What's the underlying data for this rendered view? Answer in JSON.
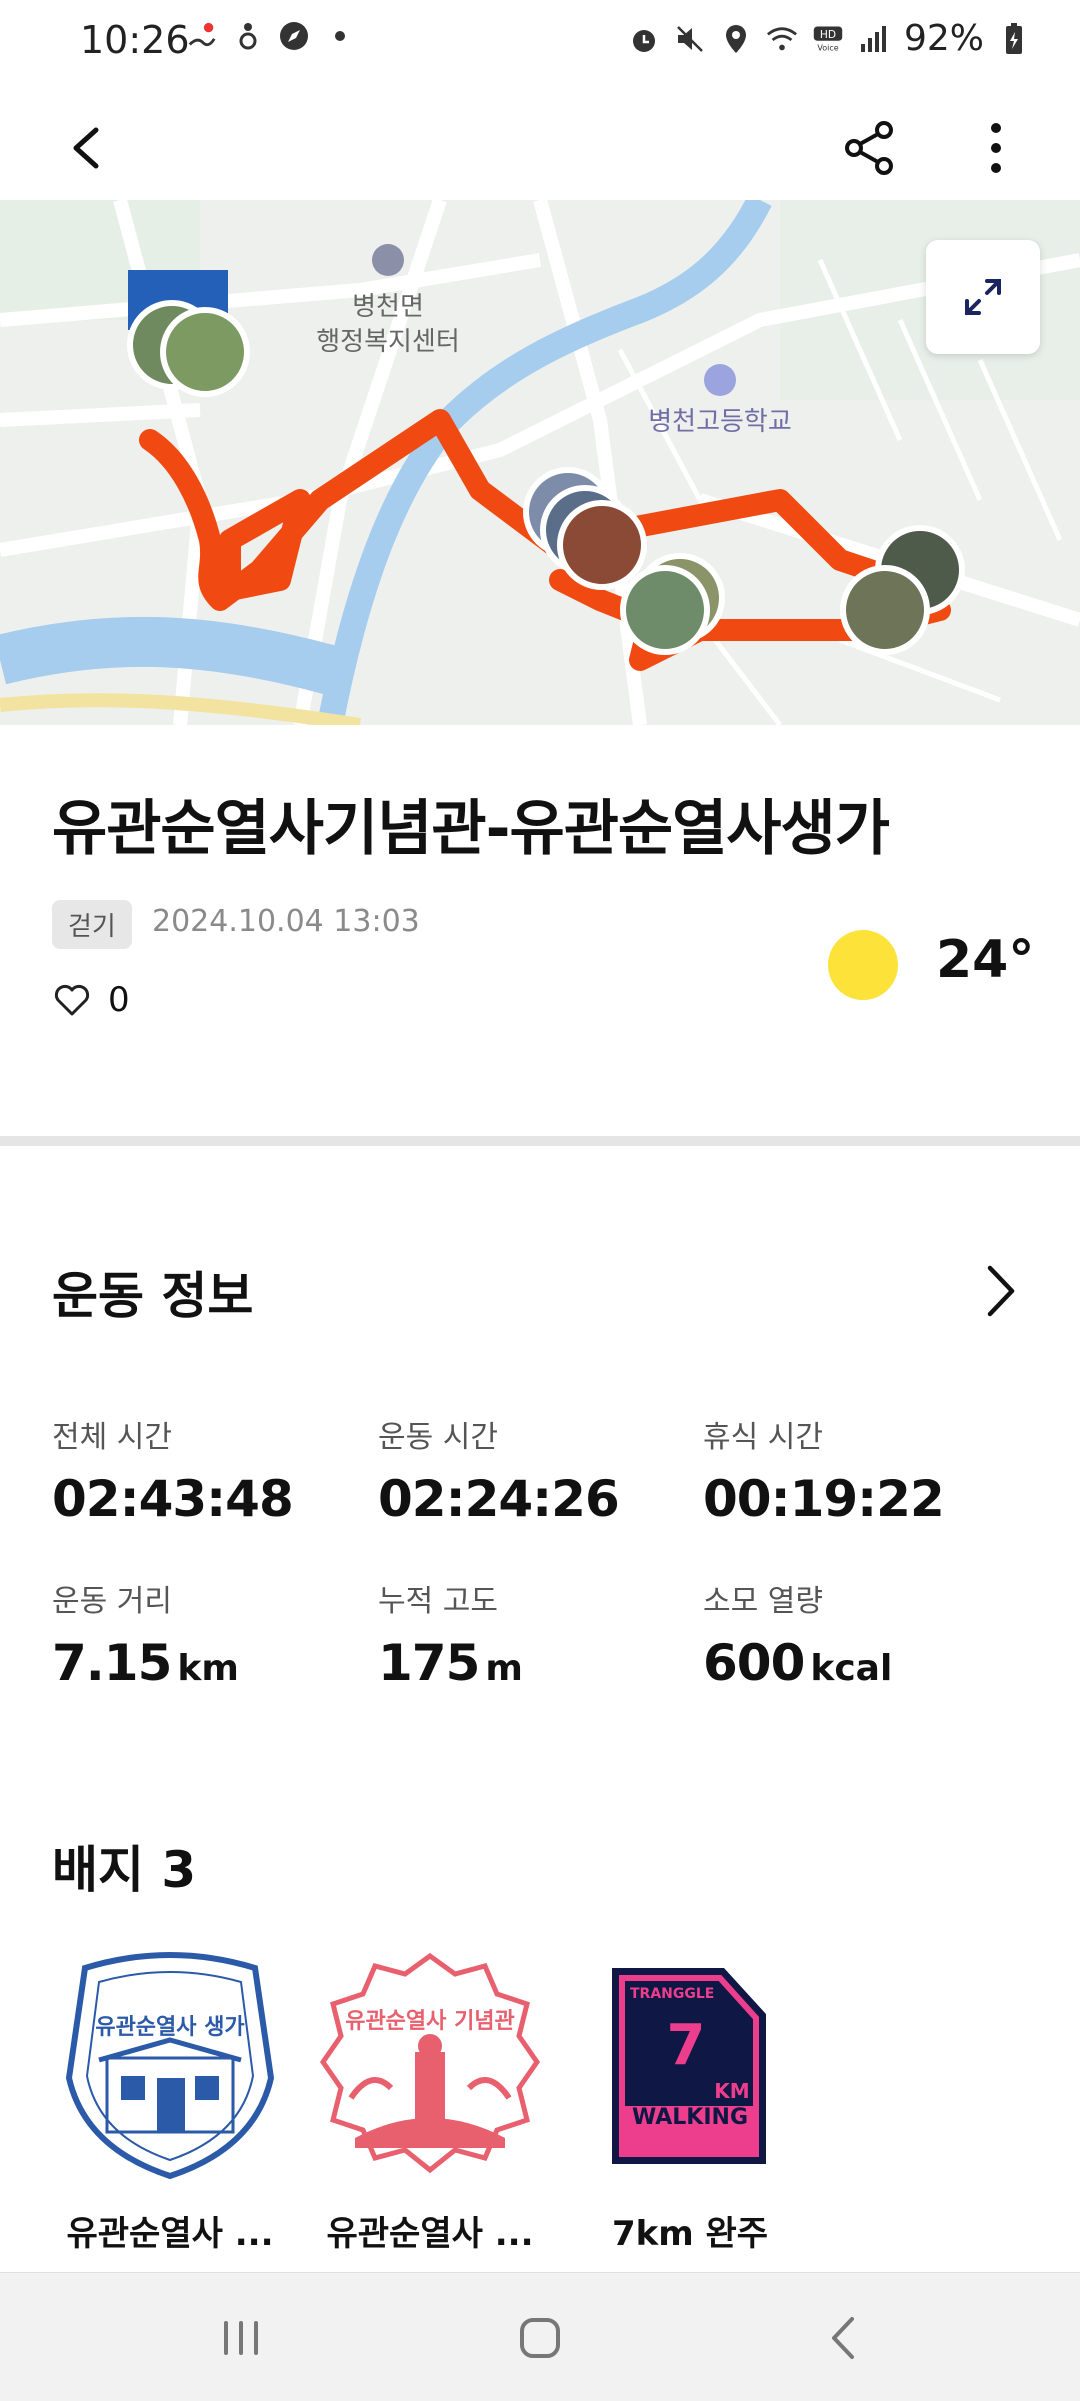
{
  "status_bar": {
    "time": "10:26",
    "battery": "92%"
  },
  "map": {
    "labels": [
      "병천면",
      "행정복지센터",
      "병천고등학교"
    ],
    "route_color": "#f04a12"
  },
  "activity": {
    "title": "유관순열사기념관-유관순열사생가",
    "type_tag": "걷기",
    "datetime": "2024.10.04 13:03",
    "likes": "0",
    "temperature": "24°"
  },
  "exercise_info": {
    "heading": "운동 정보",
    "stats": [
      {
        "label": "전체 시간",
        "value": "02:43:48",
        "unit": ""
      },
      {
        "label": "운동 시간",
        "value": "02:24:26",
        "unit": ""
      },
      {
        "label": "휴식 시간",
        "value": "00:19:22",
        "unit": ""
      },
      {
        "label": "운동 거리",
        "value": "7.15",
        "unit": "km"
      },
      {
        "label": "누적 고도",
        "value": "175",
        "unit": "m"
      },
      {
        "label": "소모 열량",
        "value": "600",
        "unit": "kcal"
      }
    ]
  },
  "badges": {
    "heading": "배지 3",
    "items": [
      {
        "label": "유관순열사 ...",
        "stamp_text": "유관순열사 생가",
        "color": "#2a5aa8"
      },
      {
        "label": "유관순열사 ...",
        "stamp_text": "유관순열사 기념관",
        "color": "#e8606e"
      },
      {
        "label": "7km 완주",
        "stamp_top": "TRANGGLE",
        "stamp_num": "7",
        "stamp_unit": "KM",
        "stamp_text": "WALKING",
        "color": "#ec3e8d"
      }
    ]
  }
}
